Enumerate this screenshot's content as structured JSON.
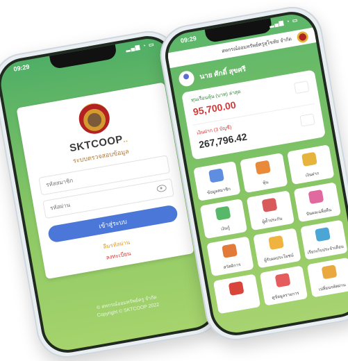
{
  "status_time": "09:29",
  "status_icons": "▂▄▆ ◔ ▭",
  "login": {
    "brand": "SKTCOOP",
    "brand_suffix": "..",
    "subtitle": "ระบบตรวจสอบข้อมูล",
    "username_placeholder": "รหัสสมาชิก",
    "password_placeholder": "รหัสผ่าน",
    "login_button": "เข้าสู่ระบบ",
    "forgot_link": "ลืมรหัสผ่าน",
    "register_link": "ลงทะเบียน",
    "footer_line1": "© สหกรณ์ออมทรัพย์ครู จำกัด",
    "footer_line2": "Copyright © SKTCOOP 2022"
  },
  "home": {
    "header_title": "สหกรณ์ออมทรัพย์ครูสุโขทัย จำกัด",
    "user_name": "นาย ศักดิ์ สุขศรี",
    "balance1_label": "ทุนเรือนหุ้น (บาท) ล่าสุด",
    "balance1_value": "95,700.00",
    "balance2_label": "เงินฝาก (3 บัญชี)",
    "balance2_value": "267,796.42",
    "tiles": [
      {
        "label": "ข้อมูลสมาชิก",
        "color": "#5f8de0"
      },
      {
        "label": "หุ้น",
        "color": "#e88a3a"
      },
      {
        "label": "เงินฝาก",
        "color": "#e6b33c"
      },
      {
        "label": "เงินกู้",
        "color": "#57b86a"
      },
      {
        "label": "ผู้ค้ำประกัน",
        "color": "#d95a5a"
      },
      {
        "label": "ปันผลเฉลี่ยคืน",
        "color": "#e06aa0"
      },
      {
        "label": "สวัสดิการ",
        "color": "#e27a3a"
      },
      {
        "label": "ผู้รับผลประโยชน์",
        "color": "#f0b340"
      },
      {
        "label": "เรียกเก็บประจำเดือน",
        "color": "#4ba6d6"
      },
      {
        "label": "",
        "color": "#d8453a"
      },
      {
        "label": "ดูข้อมูลรายการ",
        "color": "#e45c5c"
      },
      {
        "label": "เปลี่ยนรหัสผ่าน",
        "color": "#e9a940"
      }
    ]
  }
}
